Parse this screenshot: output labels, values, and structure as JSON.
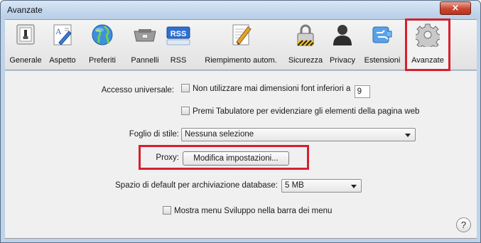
{
  "window": {
    "title": "Avanzate",
    "close_glyph": "×"
  },
  "toolbar": {
    "items": [
      {
        "label": "Generale",
        "icon": "switch-icon"
      },
      {
        "label": "Aspetto",
        "icon": "font-appearance-icon"
      },
      {
        "label": "Preferiti",
        "icon": "globe-icon"
      },
      {
        "label": "Pannelli",
        "icon": "tabs-panel-icon"
      },
      {
        "label": "RSS",
        "icon": "rss-icon",
        "icon_text": "RSS"
      },
      {
        "label": "Riempimento autom.",
        "icon": "pencil-document-icon"
      },
      {
        "label": "Sicurezza",
        "icon": "lock-icon"
      },
      {
        "label": "Privacy",
        "icon": "person-silhouette-icon"
      },
      {
        "label": "Estensioni",
        "icon": "extension-puzzle-icon"
      },
      {
        "label": "Avanzate",
        "icon": "gear-icon",
        "selected": true
      }
    ]
  },
  "settings": {
    "universal_access": {
      "label": "Accesso universale:",
      "min_font_option": "Non utilizzare mai dimensioni font inferiori a",
      "min_font_value": "9",
      "tab_option": "Premi Tabulatore per evidenziare gli elementi della pagina web"
    },
    "stylesheet": {
      "label": "Foglio di stile:",
      "value": "Nessuna selezione"
    },
    "proxy": {
      "label": "Proxy:",
      "button": "Modifica impostazioni..."
    },
    "database": {
      "label": "Spazio di default per archiviazione database:",
      "value": "5 MB"
    },
    "develop_menu": {
      "label": "Mostra menu Sviluppo nella barra dei menu"
    },
    "help_glyph": "?"
  },
  "colors": {
    "highlight": "#d71f2e",
    "titlebar": "#c2d6ec",
    "panel": "#f0f0f0"
  }
}
